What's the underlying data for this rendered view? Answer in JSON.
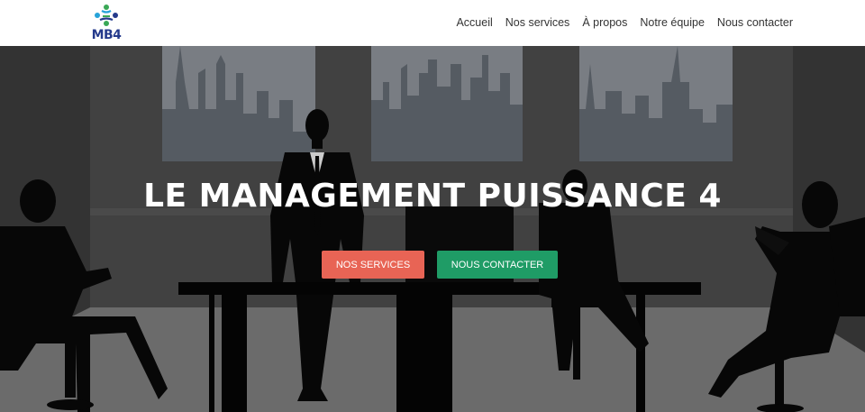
{
  "brand": {
    "logo_text": "MB4",
    "colors": {
      "blue": "#253a8c",
      "green": "#3aa856",
      "logo_accent": "#26a3d9"
    }
  },
  "nav": {
    "items": [
      {
        "label": "Accueil"
      },
      {
        "label": "Nos services"
      },
      {
        "label": "À propos"
      },
      {
        "label": "Notre équipe"
      },
      {
        "label": "Nous contacter"
      }
    ]
  },
  "hero": {
    "title": "LE MANAGEMENT PUISSANCE 4",
    "primary_button": {
      "label": "Nos services",
      "color": "#e86455"
    },
    "secondary_button": {
      "label": "Nous contacter",
      "color": "#1f9c66"
    }
  }
}
